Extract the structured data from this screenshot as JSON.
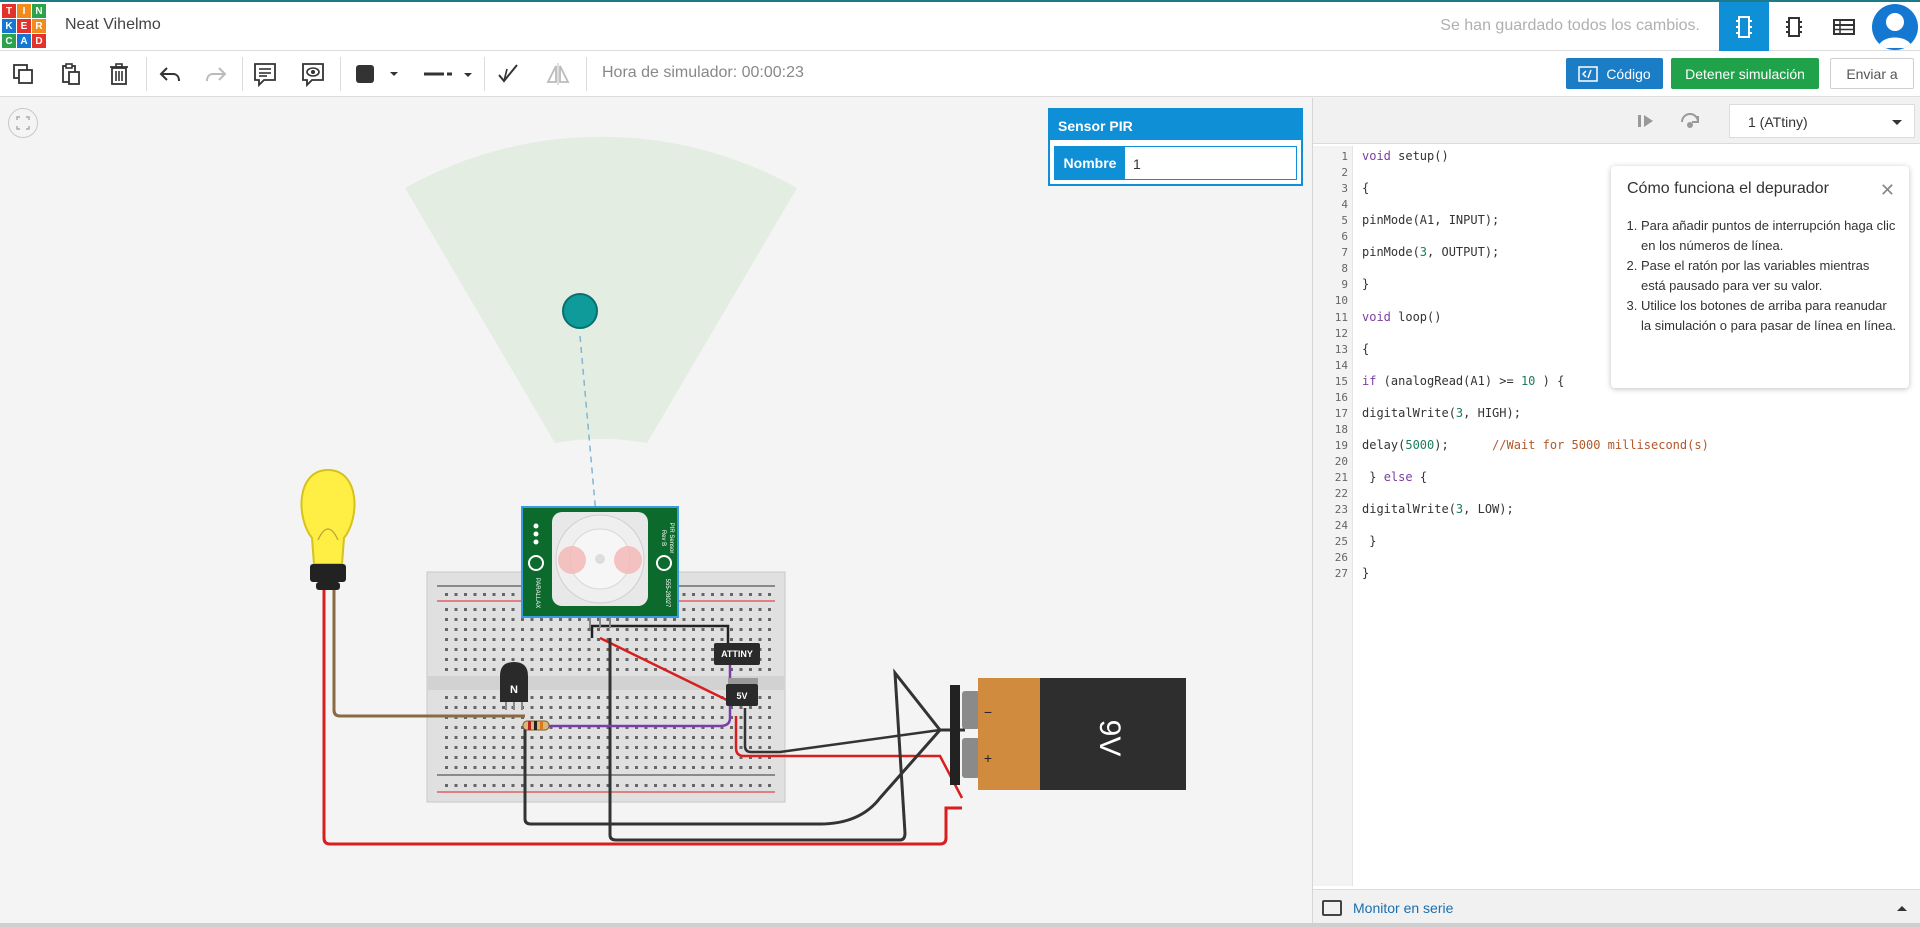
{
  "header": {
    "logo_letters": [
      "T",
      "I",
      "N",
      "K",
      "E",
      "R",
      "C",
      "A",
      "D"
    ],
    "logo_colors": [
      "#e3322b",
      "#f08b1d",
      "#2ea24a",
      "#1477d2",
      "#e3322b",
      "#f08b1d",
      "#2ea24a",
      "#1477d2",
      "#e3322b"
    ],
    "project_title": "Neat Vihelmo",
    "save_status": "Se han guardado todos los cambios.",
    "view_buttons": [
      "circuit-view-icon",
      "schematic-view-icon",
      "component-list-icon"
    ]
  },
  "toolbar": {
    "sim_time_label": "Hora de simulador: 00:00:23",
    "code_label": "Código",
    "stop_label": "Detener simulación",
    "send_label": "Enviar a"
  },
  "inspector": {
    "title": "Sensor PIR",
    "name_label": "Nombre",
    "name_value": "1"
  },
  "code_panel": {
    "device": "1 (ATtiny)",
    "lines": [
      [
        {
          "t": "void",
          "c": "kw"
        },
        {
          "t": " setup()"
        }
      ],
      [],
      [
        {
          "t": "{"
        }
      ],
      [],
      [
        {
          "t": "pinMode(A1, INPUT);"
        }
      ],
      [],
      [
        {
          "t": "pinMode("
        },
        {
          "t": "3",
          "c": "num"
        },
        {
          "t": ", OUTPUT);"
        }
      ],
      [],
      [
        {
          "t": "}"
        }
      ],
      [],
      [
        {
          "t": "void",
          "c": "kw"
        },
        {
          "t": " loop()"
        }
      ],
      [],
      [
        {
          "t": "{"
        }
      ],
      [],
      [
        {
          "t": "if",
          "c": "kw"
        },
        {
          "t": " (analogRead(A1) >= "
        },
        {
          "t": "10",
          "c": "num"
        },
        {
          "t": " ) {"
        }
      ],
      [],
      [
        {
          "t": "digitalWrite("
        },
        {
          "t": "3",
          "c": "num"
        },
        {
          "t": ", HIGH);"
        }
      ],
      [],
      [
        {
          "t": "delay("
        },
        {
          "t": "5000",
          "c": "num"
        },
        {
          "t": ");      "
        },
        {
          "t": "//Wait for 5000 millisecond(s)",
          "c": "cmt"
        }
      ],
      [],
      [
        {
          "t": " } "
        },
        {
          "t": "else",
          "c": "kw"
        },
        {
          "t": " {"
        }
      ],
      [],
      [
        {
          "t": "digitalWrite("
        },
        {
          "t": "3",
          "c": "num"
        },
        {
          "t": ", LOW);"
        }
      ],
      [],
      [
        {
          "t": " }"
        }
      ],
      [],
      [
        {
          "t": "}"
        }
      ]
    ],
    "debug_help": {
      "title": "Cómo funciona el depurador",
      "items": [
        "Para añadir puntos de interrupción haga clic en los números de línea.",
        "Pase el ratón por las variables mientras está pausado para ver su valor.",
        "Utilice los botones de arriba para reanudar la simulación o para pasar de línea en línea."
      ]
    },
    "serial_monitor_label": "Monitor en serie"
  },
  "circuit": {
    "pir_module_labels": [
      "PIR Sensor",
      "Rev B",
      "555-28027",
      "PARALLAX"
    ],
    "transistor_label": "N",
    "chip_label": "ATTINY",
    "regulator_label": "5V",
    "battery_label": "9V",
    "battery_minus": "−",
    "battery_plus": "+"
  }
}
